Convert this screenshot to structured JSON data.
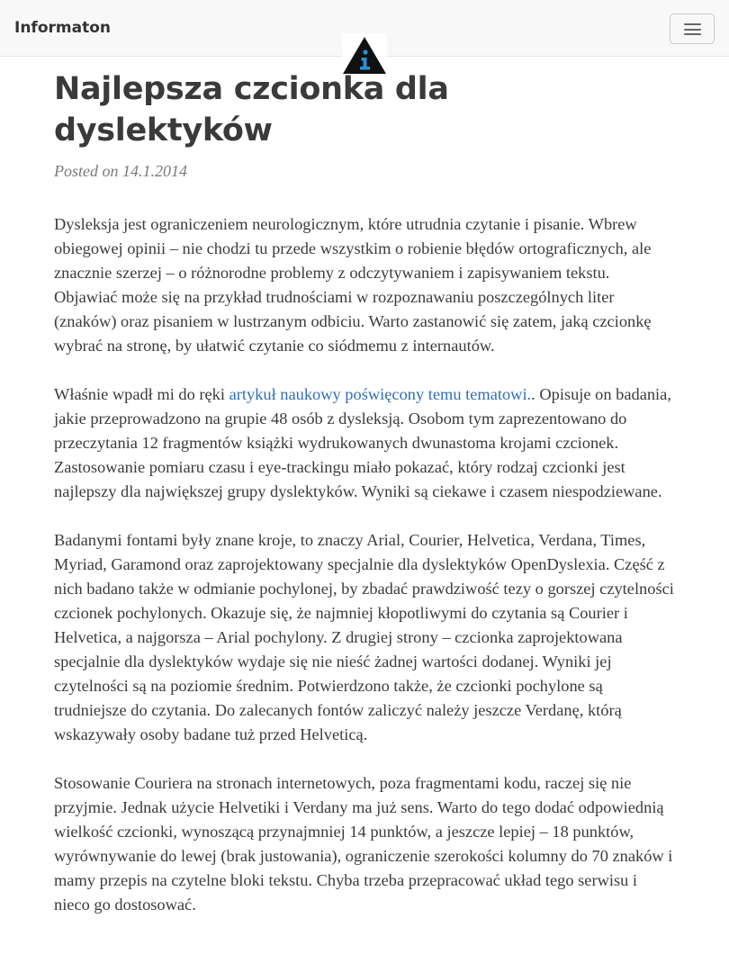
{
  "nav": {
    "brand": "Informaton",
    "toggle_icon": "hamburger-icon",
    "logo_icon": "info-triangle-icon",
    "logo_letter": "i"
  },
  "post": {
    "title": "Najlepsza czcionka dla dyslektyków",
    "posted_prefix": "Posted on",
    "date": "14.1.2014",
    "paragraphs": [
      "Dysleksja jest ograniczeniem neurologicznym, które utrudnia czytanie i pisanie. Wbrew obiegowej opinii – nie chodzi tu przede wszystkim o robienie błędów ortograficznych, ale znacznie szerzej – o różnorodne problemy z odczytywaniem i zapisywaniem tekstu. Objawiać może się na przykład trudnościami w rozpoznawaniu poszczególnych liter (znaków) oraz pisaniem w lustrzanym odbiciu. Warto zastanowić się zatem, jaką czcionkę wybrać na stronę, by ułatwić czytanie co siódmemu z internautów.",
      "",
      "Badanymi fontami były znane kroje, to znaczy Arial, Courier, Helvetica, Verdana, Times, Myriad, Garamond oraz zaprojektowany specjalnie dla dyslektyków OpenDyslexia. Część z nich badano także w odmianie pochylonej, by zbadać prawdziwość tezy o gorszej czytelności czcionek pochylonych. Okazuje się, że najmniej kłopotliwymi do czytania są Courier i Helvetica, a najgorsza – Arial pochylony. Z drugiej strony – czcionka zaprojektowana specjalnie dla dyslektyków wydaje się nie nieść żadnej wartości dodanej. Wyniki jej czytelności są na poziomie średnim. Potwierdzono także, że czcionki pochylone są trudniejsze do czytania. Do zalecanych fontów zaliczyć należy jeszcze Verdanę, którą wskazywały osoby badane tuż przed Helveticą.",
      "Stosowanie Couriera na stronach internetowych, poza fragmentami kodu, raczej się nie przyjmie. Jednak użycie Helvetiki i Verdany ma już sens. Warto do tego dodać odpowiednią wielkość czcionki, wynoszącą przynajmniej 14 punktów, a jeszcze lepiej – 18 punktów, wyrównywanie do lewej (brak justowania), ograniczenie szerokości kolumny do 70 znaków i mamy przepis na czytelne bloki tekstu. Chyba trzeba przepracować układ tego serwisu i nieco go dostosować."
    ],
    "p2_before": "Właśnie wpadł mi do ręki ",
    "p2_link": "artykuł naukowy poświęcony temu tematowi.",
    "p2_after": ". Opisuje on badania, jakie przeprowadzono na grupie 48 osób z dysleksją. Osobom tym zaprezentowano do przeczytania 12 fragmentów książki wydrukowanych dwunastoma krojami czcionek. Zastosowanie pomiaru czasu i eye-trackingu miało pokazać, który rodzaj czcionki jest najlepszy dla największej grupy dyslektyków. Wyniki są ciekawe i czasem niespodziewane."
  },
  "colors": {
    "link": "#2f6fb5",
    "navbar_bg": "#f8f8f8",
    "logo_triangle": "#111111",
    "logo_letter": "#2a8fd6"
  }
}
